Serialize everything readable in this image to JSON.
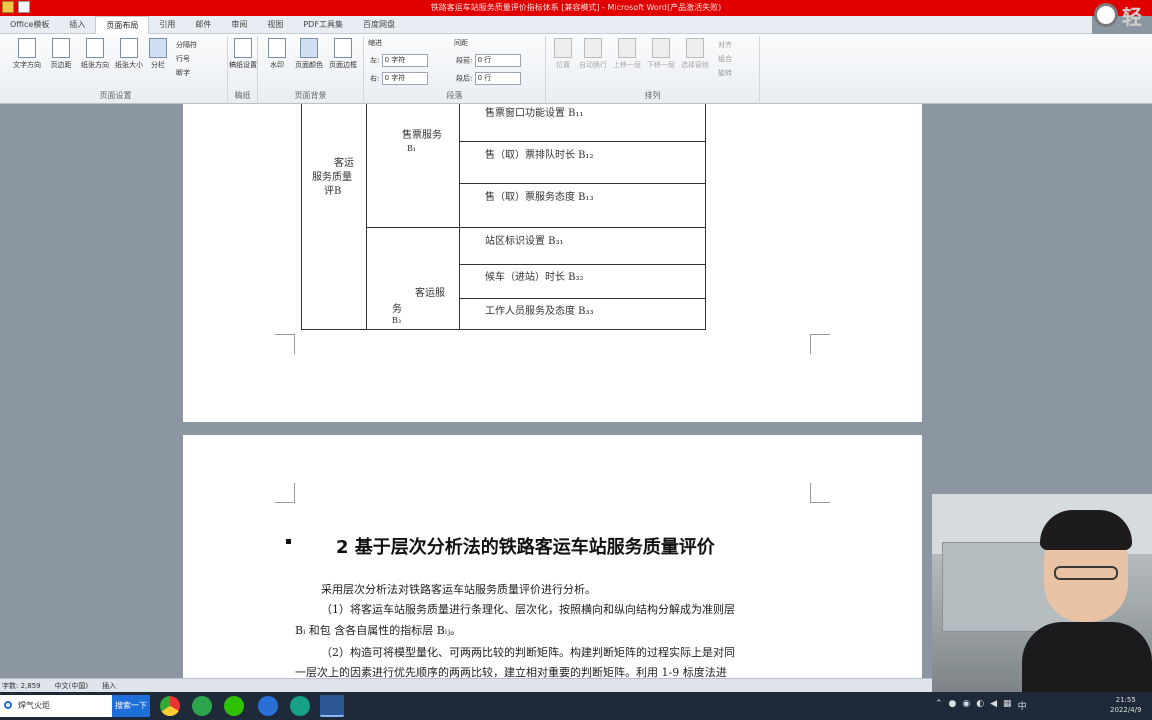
{
  "window": {
    "title": "铁路客运车站服务质量评价指标体系 [兼容模式] - Microsoft Word(产品激活失败)",
    "light_button_text": "轻"
  },
  "tabs": [
    "Office模板",
    "插入",
    "页面布局",
    "引用",
    "邮件",
    "审阅",
    "视图",
    "PDF工具集",
    "百度网盘"
  ],
  "active_tab": "页面布局",
  "ribbon": {
    "page_setup": {
      "buttons": [
        "文字方向",
        "页边距",
        "纸张方向",
        "纸张大小",
        "分栏"
      ],
      "small": [
        "分隔符",
        "行号",
        "断字"
      ],
      "label": "页面设置"
    },
    "draft": {
      "button": "稿纸设置",
      "label": "稿纸"
    },
    "background": {
      "buttons": [
        "水印",
        "页面颜色",
        "页面边框"
      ],
      "label": "页面背景"
    },
    "paragraph": {
      "indent_title": "缩进",
      "spacing_title": "间距",
      "left_label": "左:",
      "left_value": "0 字符",
      "right_label": "右:",
      "right_value": "0 字符",
      "before_label": "段前:",
      "before_value": "0 行",
      "after_label": "段后:",
      "after_value": "0 行",
      "label": "段落"
    },
    "arrange": {
      "buttons": [
        "位置",
        "自动换行",
        "上移一层",
        "下移一层",
        "选择窗格"
      ],
      "small": [
        "对齐",
        "组合",
        "旋转"
      ],
      "label": "排列"
    }
  },
  "table": {
    "criterion": [
      "客运",
      "服务质量",
      "评B"
    ],
    "group1": [
      "售票服务",
      "B₁"
    ],
    "group2": [
      "客运服",
      "务",
      "B₃"
    ],
    "rows": [
      "售票窗口功能设置 B₁₁",
      "售（取）票排队时长 B₁₂",
      "售（取）票服务态度 B₁₃",
      "站区标识设置 B₃₁",
      "候车（进站）时长 B₃₂",
      "工作人员服务及态度 B₃₃"
    ]
  },
  "section": {
    "heading": "2 基于层次分析法的铁路客运车站服务质量评价",
    "paragraphs": [
      "采用层次分析法对铁路客运车站服务质量评价进行分析。",
      "（1）将客运车站服务质量进行条理化、层次化，按照横向和纵向结构分解成为准则层",
      "Bᵢ 和包 含各自属性的指标层 Bᵢⱼ。",
      "（2）构造可将模型量化、可两两比较的判断矩阵。构建判断矩阵的过程实际上是对同",
      "一层次上的因素进行优先顺序的两两比较，建立相对重要的判断矩阵。利用 1-9 标度法进"
    ]
  },
  "statusbar": {
    "words": "字数: 2,859",
    "language": "中文(中国)",
    "mode": "插入"
  },
  "taskbar": {
    "search_text": "焊气火炬",
    "search_button": "搜索一下",
    "tray_text": "中",
    "time": "21:55",
    "date": "2022/4/9"
  }
}
